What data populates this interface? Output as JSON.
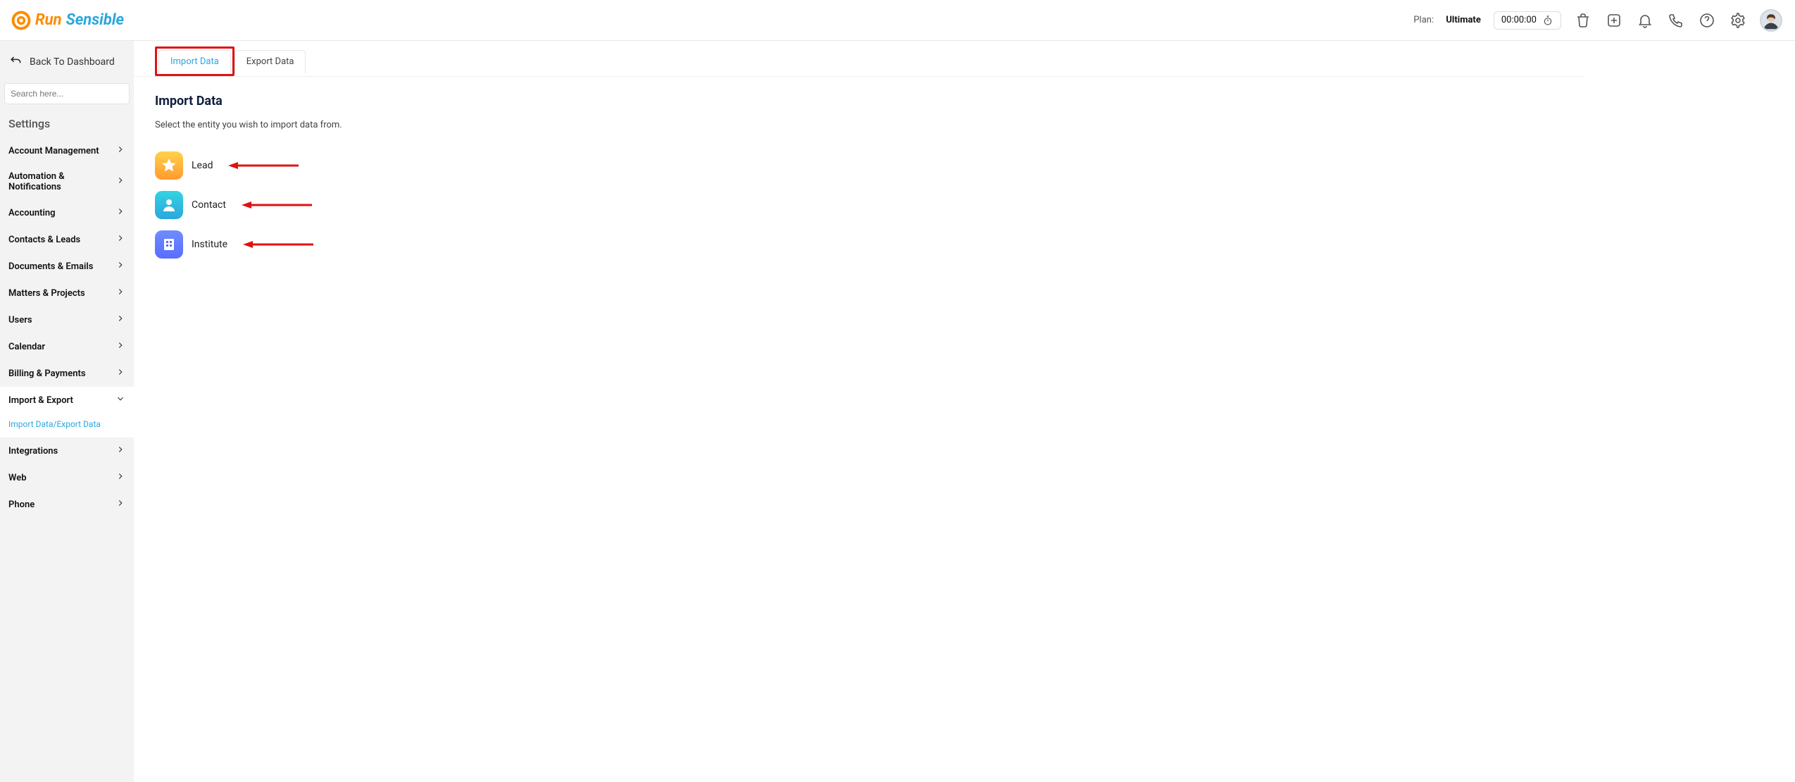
{
  "header": {
    "logo_word1": "Run",
    "logo_word2": "Sensible",
    "plan_label": "Plan:",
    "plan_value": "Ultimate",
    "timer_value": "00:00:00"
  },
  "sidebar": {
    "back_label": "Back To Dashboard",
    "search_placeholder": "Search here...",
    "settings_label": "Settings",
    "items": [
      {
        "label": "Account Management",
        "expanded": false
      },
      {
        "label": "Automation & Notifications",
        "expanded": false
      },
      {
        "label": "Accounting",
        "expanded": false
      },
      {
        "label": "Contacts & Leads",
        "expanded": false
      },
      {
        "label": "Documents & Emails",
        "expanded": false
      },
      {
        "label": "Matters & Projects",
        "expanded": false
      },
      {
        "label": "Users",
        "expanded": false
      },
      {
        "label": "Calendar",
        "expanded": false
      },
      {
        "label": "Billing & Payments",
        "expanded": false
      },
      {
        "label": "Import & Export",
        "expanded": true
      },
      {
        "label": "Integrations",
        "expanded": false
      },
      {
        "label": "Web",
        "expanded": false
      },
      {
        "label": "Phone",
        "expanded": false
      }
    ],
    "import_export_sub": "Import Data/Export Data"
  },
  "tabs": {
    "import": "Import Data",
    "export": "Export Data"
  },
  "page": {
    "title": "Import Data",
    "subtitle": "Select the entity you wish to import data from.",
    "entities": [
      {
        "label": "Lead"
      },
      {
        "label": "Contact"
      },
      {
        "label": "Institute"
      }
    ]
  }
}
